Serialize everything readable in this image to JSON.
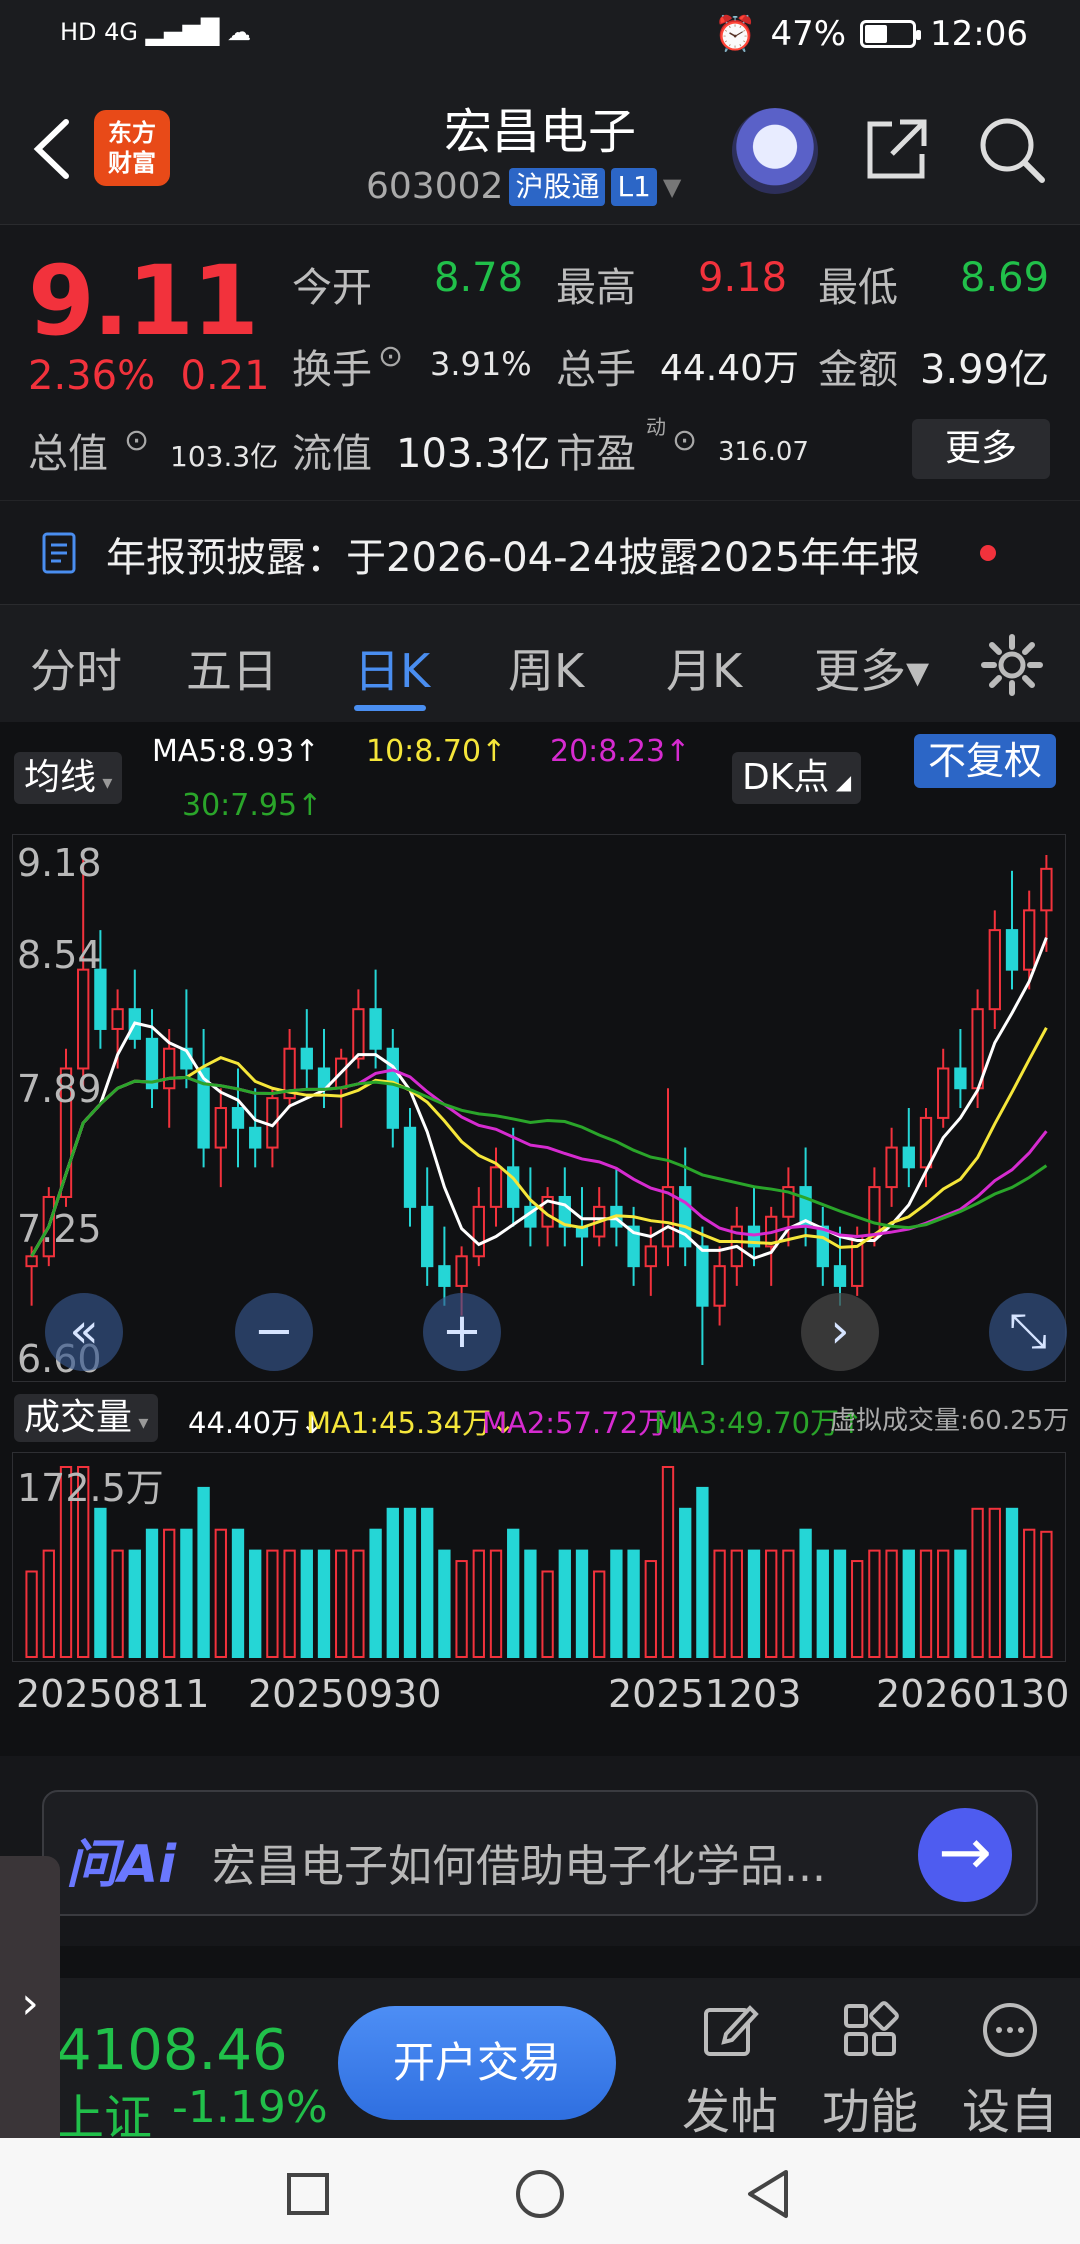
{
  "status_bar": {
    "left_icons": "HD 4G ▂▄▆█ ☁",
    "alarm": "⏰",
    "battery_pct": "47%",
    "battery_level": 0.47,
    "time": "12:06"
  },
  "header": {
    "logo_line1": "东方",
    "logo_line2": "财富",
    "title": "宏昌电子",
    "code": "603002",
    "tag_connect": "沪股通",
    "tag_level": "L1"
  },
  "quote": {
    "price": "9.11",
    "change_pct": "2.36%",
    "change_abs": "0.21",
    "open_label": "今开",
    "open": "8.78",
    "high_label": "最高",
    "high": "9.18",
    "low_label": "最低",
    "low": "8.69",
    "turnover_label": "换手",
    "turnover": "3.91%",
    "volume_label": "总手",
    "volume": "44.40万",
    "amount_label": "金额",
    "amount": "3.99亿",
    "mktcap_label": "总值",
    "mktcap": "103.3亿",
    "float_label": "流值",
    "float": "103.3亿",
    "pe_label": "市盈",
    "pe_sup": "动",
    "pe": "316.07",
    "more": "更多"
  },
  "announcement": "年报预披露：于2026-04-24披露2025年年报",
  "tabs": [
    "分时",
    "五日",
    "日K",
    "周K",
    "月K",
    "更多▾"
  ],
  "active_tab": "日K",
  "ma_bar": {
    "mode": "均线",
    "ma5": "MA5:8.93↑",
    "ma10": "10:8.70↑",
    "ma20": "20:8.23↑",
    "ma30": "30:7.95↑",
    "dk": "DK点",
    "adjust": "不复权"
  },
  "chart_labels": {
    "y_ticks": [
      "9.18",
      "8.54",
      "7.89",
      "7.25",
      "6.60"
    ],
    "vol_max": "172.5万",
    "dates": [
      "20250811",
      "20250930",
      "20251203",
      "20260130"
    ]
  },
  "volume_bar": {
    "mode": "成交量",
    "vol": "44.40万↓",
    "ma1": "MA1:45.34万↓",
    "ma2": "MA2:57.72万↓",
    "ma3": "MA3:49.70万↑",
    "virtual": "虚拟成交量:60.25万"
  },
  "controls": {
    "rewind": "«",
    "zoom_out": "−",
    "zoom_in": "+",
    "next": "›",
    "expand": "⤡"
  },
  "ai": {
    "logo": "问Ai",
    "question": "宏昌电子如何借助电子化学品...",
    "go": "→"
  },
  "bottom": {
    "index_value": "4108.46",
    "index_name": "上证",
    "index_change": "-1.19%",
    "trade": "开户交易",
    "post": "发帖",
    "func": "功能",
    "settings": "设自"
  },
  "colors": {
    "up": "#f2323c",
    "down": "#21c04a",
    "accent": "#4a8ef0",
    "ma5": "#ffffff",
    "ma10": "#f5e63a",
    "ma20": "#d62bd0",
    "ma30": "#2aa52a",
    "down_candle": "#25d6d6"
  },
  "chart_data": {
    "type": "candlestick",
    "y_range": [
      6.6,
      9.18
    ],
    "x_labels": [
      "20250811",
      "20250930",
      "20251203",
      "20260130"
    ],
    "ohlc": [
      [
        7.1,
        7.2,
        6.9,
        7.15
      ],
      [
        7.15,
        7.5,
        7.1,
        7.45
      ],
      [
        7.45,
        8.2,
        7.4,
        8.1
      ],
      [
        8.1,
        9.18,
        8.0,
        8.6
      ],
      [
        8.6,
        8.8,
        8.2,
        8.3
      ],
      [
        8.3,
        8.5,
        8.1,
        8.4
      ],
      [
        8.4,
        8.6,
        8.2,
        8.25
      ],
      [
        8.25,
        8.4,
        7.9,
        8.0
      ],
      [
        8.0,
        8.3,
        7.8,
        8.2
      ],
      [
        8.2,
        8.5,
        8.0,
        8.1
      ],
      [
        8.1,
        8.3,
        7.6,
        7.7
      ],
      [
        7.7,
        8.0,
        7.5,
        7.9
      ],
      [
        7.9,
        8.1,
        7.6,
        7.8
      ],
      [
        7.8,
        8.0,
        7.6,
        7.7
      ],
      [
        7.7,
        8.0,
        7.6,
        7.95
      ],
      [
        7.95,
        8.3,
        7.9,
        8.2
      ],
      [
        8.2,
        8.4,
        8.0,
        8.1
      ],
      [
        8.1,
        8.3,
        7.9,
        8.0
      ],
      [
        8.0,
        8.2,
        7.8,
        8.15
      ],
      [
        8.15,
        8.5,
        8.1,
        8.4
      ],
      [
        8.4,
        8.6,
        8.1,
        8.2
      ],
      [
        8.2,
        8.3,
        7.7,
        7.8
      ],
      [
        7.8,
        7.9,
        7.3,
        7.4
      ],
      [
        7.4,
        7.6,
        7.0,
        7.1
      ],
      [
        7.1,
        7.3,
        6.9,
        7.0
      ],
      [
        7.0,
        7.2,
        6.85,
        7.15
      ],
      [
        7.15,
        7.5,
        7.1,
        7.4
      ],
      [
        7.4,
        7.7,
        7.3,
        7.6
      ],
      [
        7.6,
        7.8,
        7.3,
        7.4
      ],
      [
        7.4,
        7.6,
        7.2,
        7.3
      ],
      [
        7.3,
        7.5,
        7.2,
        7.45
      ],
      [
        7.45,
        7.6,
        7.2,
        7.3
      ],
      [
        7.3,
        7.5,
        7.1,
        7.25
      ],
      [
        7.25,
        7.5,
        7.2,
        7.4
      ],
      [
        7.4,
        7.6,
        7.2,
        7.3
      ],
      [
        7.3,
        7.4,
        7.0,
        7.1
      ],
      [
        7.1,
        7.3,
        6.95,
        7.2
      ],
      [
        7.2,
        8.0,
        7.1,
        7.5
      ],
      [
        7.5,
        7.7,
        7.1,
        7.2
      ],
      [
        7.2,
        7.3,
        6.6,
        6.9
      ],
      [
        6.9,
        7.2,
        6.8,
        7.1
      ],
      [
        7.1,
        7.4,
        7.0,
        7.3
      ],
      [
        7.3,
        7.5,
        7.1,
        7.2
      ],
      [
        7.2,
        7.4,
        7.0,
        7.35
      ],
      [
        7.35,
        7.6,
        7.2,
        7.5
      ],
      [
        7.5,
        7.7,
        7.2,
        7.3
      ],
      [
        7.3,
        7.4,
        7.0,
        7.1
      ],
      [
        7.1,
        7.3,
        6.9,
        7.0
      ],
      [
        7.0,
        7.3,
        6.95,
        7.25
      ],
      [
        7.25,
        7.6,
        7.2,
        7.5
      ],
      [
        7.5,
        7.8,
        7.4,
        7.7
      ],
      [
        7.7,
        7.9,
        7.5,
        7.6
      ],
      [
        7.6,
        7.9,
        7.5,
        7.85
      ],
      [
        7.85,
        8.2,
        7.8,
        8.1
      ],
      [
        8.1,
        8.3,
        7.9,
        8.0
      ],
      [
        8.0,
        8.5,
        7.9,
        8.4
      ],
      [
        8.4,
        8.9,
        8.3,
        8.8
      ],
      [
        8.8,
        9.1,
        8.5,
        8.6
      ],
      [
        8.6,
        9.0,
        8.5,
        8.9
      ],
      [
        8.9,
        9.18,
        8.69,
        9.11
      ]
    ]
  }
}
